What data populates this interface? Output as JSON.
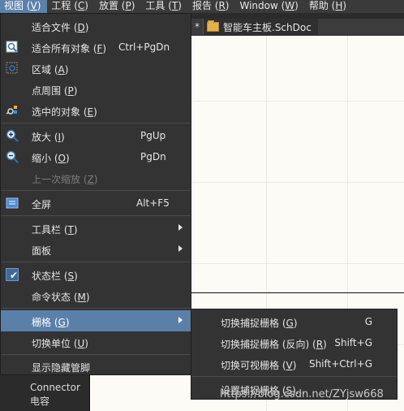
{
  "menubar": [
    {
      "label": "视图 (",
      "key": "V",
      "tail": ")",
      "active": true
    },
    {
      "label": "工程 (",
      "key": "C",
      "tail": ")"
    },
    {
      "label": "放置 (",
      "key": "P",
      "tail": ")"
    },
    {
      "label": "工具 (",
      "key": "T",
      "tail": ")"
    },
    {
      "label": "报告 (",
      "key": "R",
      "tail": ")"
    },
    {
      "label": "Window (",
      "key": "W",
      "tail": ")"
    },
    {
      "label": "帮助 (",
      "key": "H",
      "tail": ")"
    }
  ],
  "tab": {
    "star": "*",
    "title": "智能车主板.SchDoc"
  },
  "view_menu": {
    "fit_document": {
      "label": "适合文件 (",
      "key": "D",
      "tail": ")"
    },
    "fit_all": {
      "label": "适合所有对象 (",
      "key": "F",
      "tail": ")",
      "shortcut": "Ctrl+PgDn"
    },
    "area": {
      "label": "区域 (",
      "key": "A",
      "tail": ")"
    },
    "around_point": {
      "label": "点周围 (",
      "key": "P",
      "tail": ")"
    },
    "selected": {
      "label": "选中的对象 (",
      "key": "E",
      "tail": ")"
    },
    "zoom_in": {
      "label": "放大 (",
      "key": "I",
      "tail": ")",
      "shortcut": "PgUp"
    },
    "zoom_out": {
      "label": "缩小 (",
      "key": "O",
      "tail": ")",
      "shortcut": "PgDn"
    },
    "zoom_last": {
      "label": "上一次缩放 (",
      "key": "Z",
      "tail": ")"
    },
    "fullscreen": {
      "label": "全屏",
      "shortcut": "Alt+F5"
    },
    "toolbars": {
      "label": "工具栏 (",
      "key": "T",
      "tail": ")"
    },
    "panels": {
      "label": "面板"
    },
    "status_bar": {
      "label": "状态栏 (",
      "key": "S",
      "tail": ")"
    },
    "command_status": {
      "label": "命令状态 (",
      "key": "M",
      "tail": ")"
    },
    "grids": {
      "label": "栅格 (",
      "key": "G",
      "tail": ")"
    },
    "toggle_units": {
      "label": "切换单位 (",
      "key": "U",
      "tail": ")"
    },
    "show_hidden_pins": {
      "label": "显示隐藏管脚"
    }
  },
  "grid_submenu": [
    {
      "label": "切换捕捉栅格 (",
      "key": "G",
      "tail": ")",
      "shortcut": "G"
    },
    {
      "label": "切换捕捉栅格 (反向) (",
      "key": "R",
      "tail": ")",
      "shortcut": "Shift+G"
    },
    {
      "label": "切换可视栅格 (",
      "key": "V",
      "tail": ")",
      "shortcut": "Shift+Ctrl+G"
    },
    {
      "label": "设置捕捉栅格 (",
      "key": "S",
      "tail": ")..."
    }
  ],
  "side_panel": {
    "line1": "Connector",
    "line2": "电容"
  },
  "watermark": "https://blog.csdn.net/ZYjsw668",
  "colors": {
    "accent": "#5a80aa",
    "menu_bg": "#333333",
    "canvas_bg": "#fcfbf6"
  }
}
